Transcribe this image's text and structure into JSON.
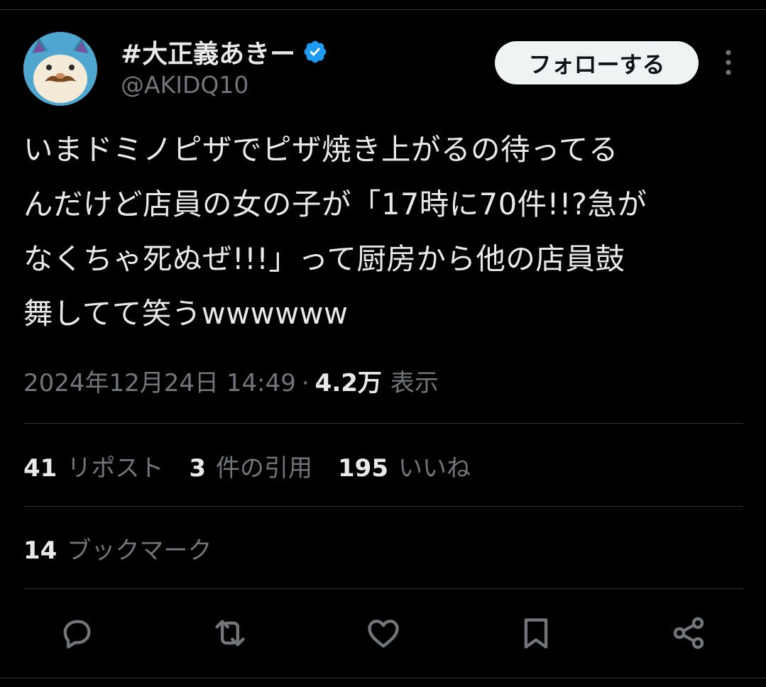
{
  "author": {
    "name": "#大正義あきー",
    "handle": "@AKIDQ10",
    "verified": true
  },
  "follow_label": "フォローする",
  "tweet": {
    "text": "いまドミノピザでピザ焼き上がるの待ってる\nんだけど店員の女の子が「17時に70件!!?急が\nなくちゃ死ぬぜ!!!」って厨房から他の店員鼓\n舞してて笑うwwwwww"
  },
  "meta": {
    "date": "2024年12月24日 14:49",
    "separator": "·",
    "views_count": "4.2万",
    "views_label": "表示"
  },
  "stats": {
    "reposts_count": "41",
    "reposts_label": "リポスト",
    "quotes_count": "3",
    "quotes_label": "件の引用",
    "likes_count": "195",
    "likes_label": "いいね",
    "bookmarks_count": "14",
    "bookmarks_label": "ブックマーク"
  },
  "icons": {
    "verified": "verified-badge-icon",
    "more": "more-vertical-icon",
    "reply": "reply-icon",
    "repost": "repost-icon",
    "like": "heart-icon",
    "bookmark": "bookmark-icon",
    "share": "share-icon"
  },
  "colors": {
    "background": "#000000",
    "text_primary": "#e7e9ea",
    "text_secondary": "#71767b",
    "divider": "#2f3336",
    "verified_blue": "#1d9bf0",
    "follow_button_bg": "#eff3f4"
  }
}
